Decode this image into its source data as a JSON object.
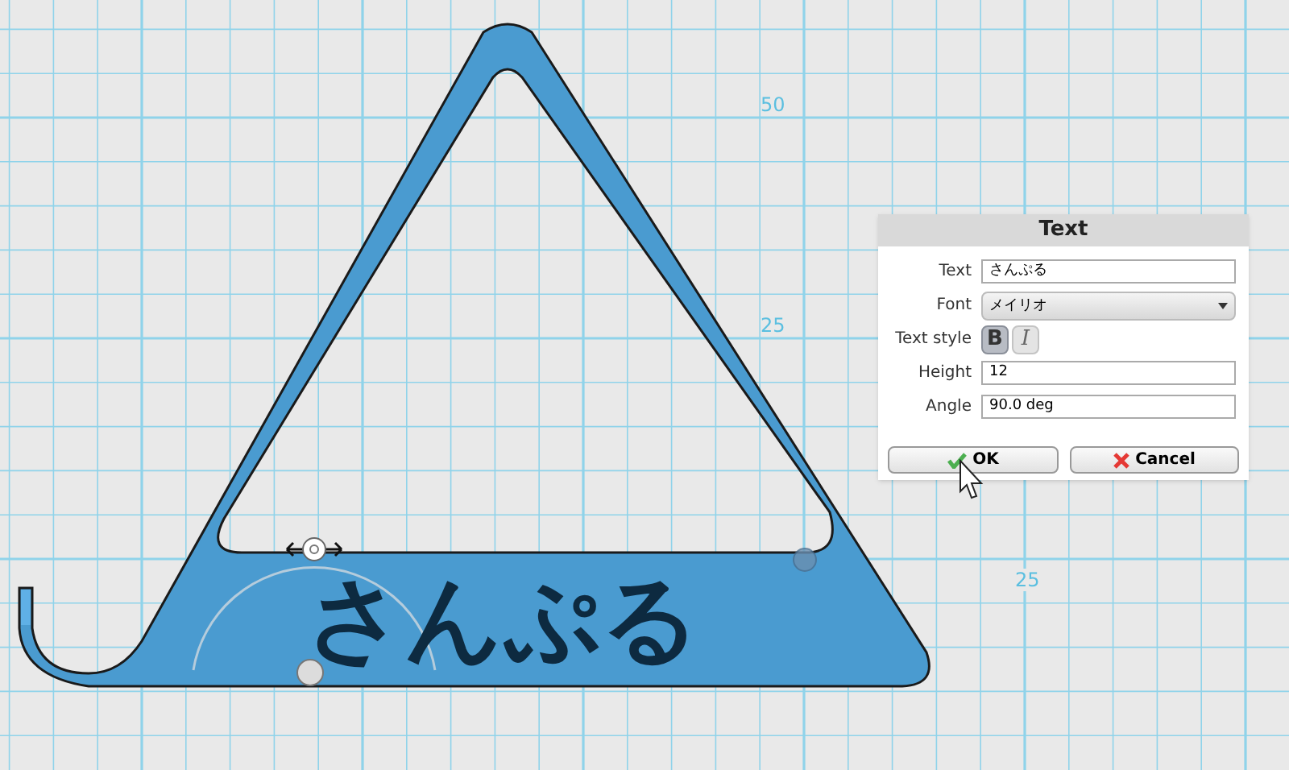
{
  "canvas": {
    "axis_labels": [
      {
        "text": "50",
        "kind": "y"
      },
      {
        "text": "25",
        "kind": "y"
      },
      {
        "text": "25",
        "kind": "x"
      }
    ],
    "model_text": "さんぷる"
  },
  "dialog": {
    "title": "Text",
    "fields": [
      {
        "kind": "text",
        "label": "Text",
        "value": "さんぷる"
      },
      {
        "kind": "select",
        "label": "Font",
        "value": "メイリオ"
      },
      {
        "kind": "style",
        "label": "Text style",
        "options": [
          {
            "label": "B",
            "selected": true
          },
          {
            "label": "I",
            "selected": false
          }
        ]
      },
      {
        "kind": "text",
        "label": "Height",
        "value": "12"
      },
      {
        "kind": "text",
        "label": "Angle",
        "value": "90.0 deg"
      }
    ],
    "buttons": [
      {
        "kind": "ok",
        "label": "OK"
      },
      {
        "kind": "cancel",
        "label": "Cancel"
      }
    ]
  }
}
